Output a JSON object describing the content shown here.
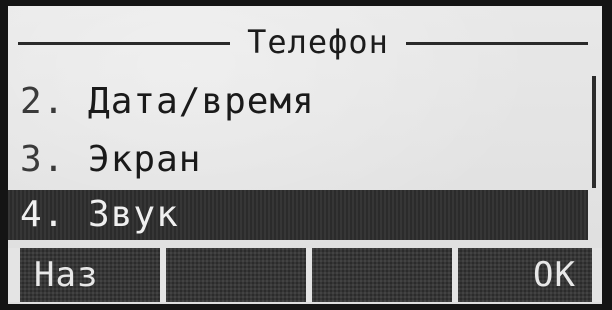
{
  "screen": {
    "title": "Телефон"
  },
  "menu": {
    "items": [
      {
        "number": "2.",
        "label": "Дата/время",
        "selected": false
      },
      {
        "number": "3.",
        "label": "Экран",
        "selected": false
      },
      {
        "number": "4.",
        "label": "Звук",
        "selected": true
      }
    ]
  },
  "softkeys": [
    {
      "label": "Наз"
    },
    {
      "label": ""
    },
    {
      "label": ""
    },
    {
      "label": "OK"
    }
  ],
  "colors": {
    "lcd_background": "#e4e4e4",
    "foreground": "#1a1a1a",
    "highlight": "#2b2b2b"
  }
}
